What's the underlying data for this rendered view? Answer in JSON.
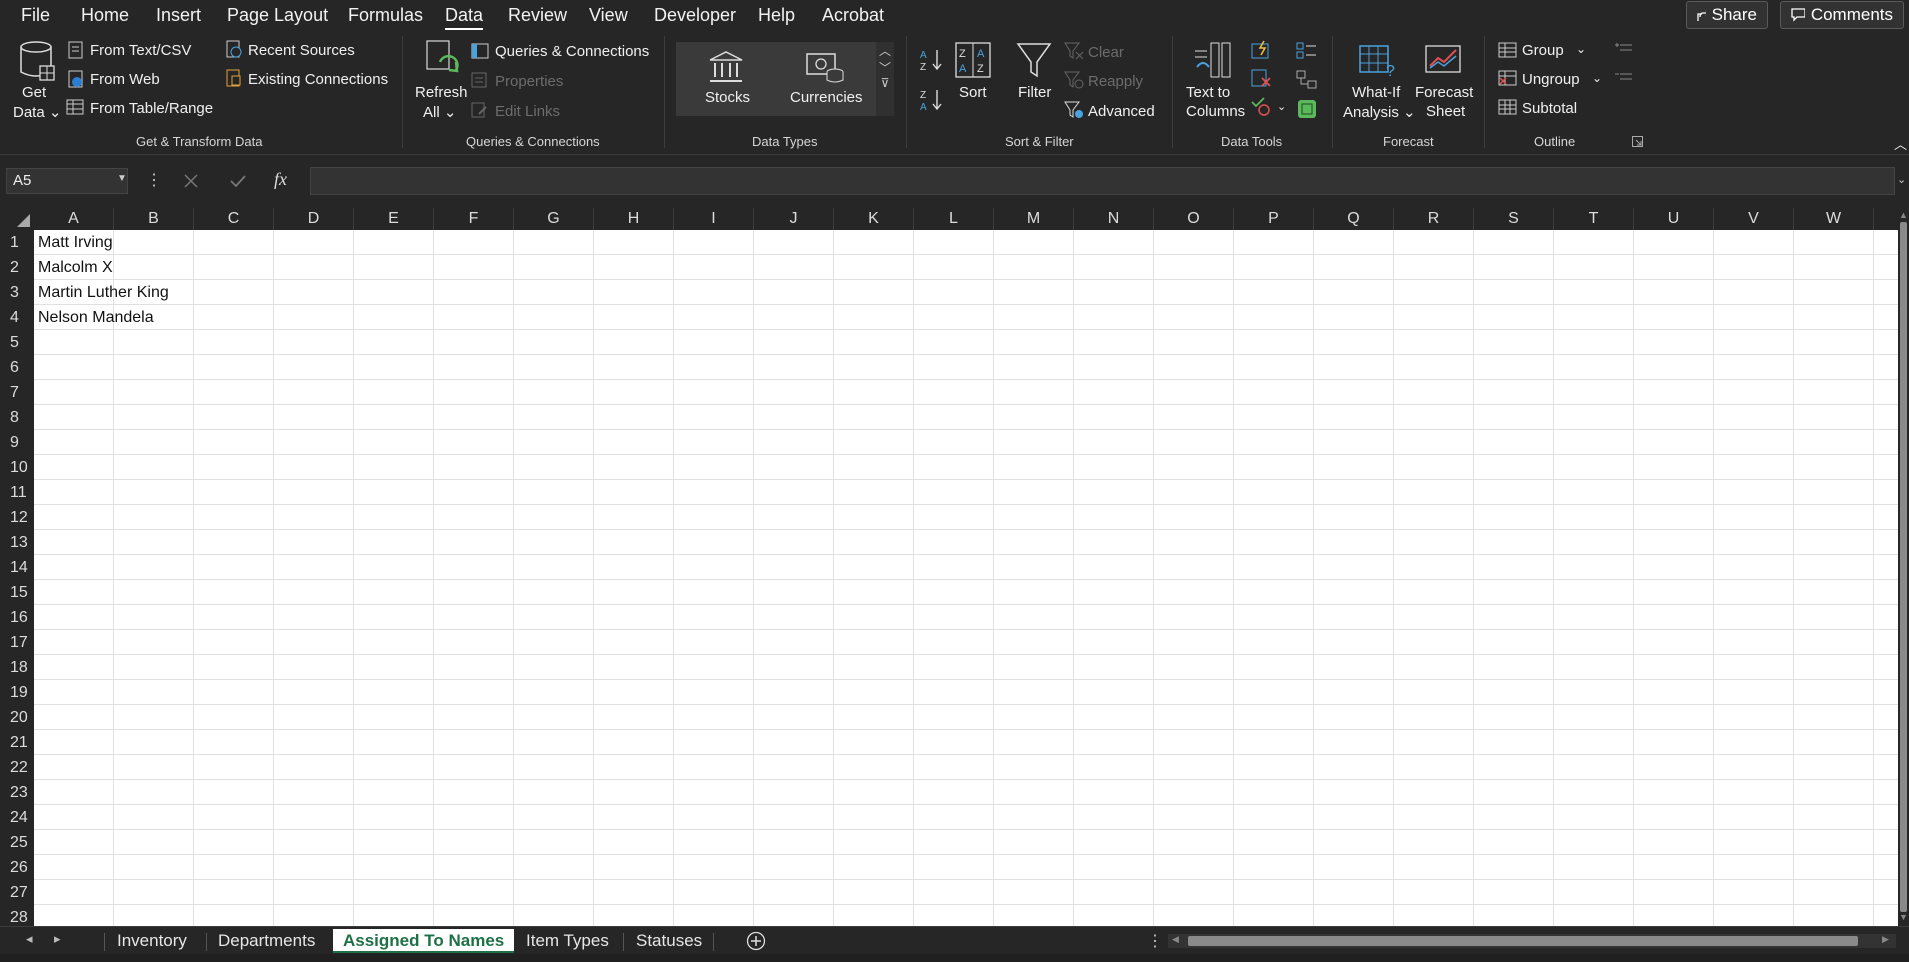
{
  "menu": {
    "items": [
      "File",
      "Home",
      "Insert",
      "Page Layout",
      "Formulas",
      "Data",
      "Review",
      "View",
      "Developer",
      "Help",
      "Acrobat"
    ],
    "active": "Data",
    "share_label": "Share",
    "comments_label": "Comments"
  },
  "ribbon": {
    "get_transform": {
      "get_data_line1": "Get",
      "get_data_line2": "Data",
      "from_text_csv": "From Text/CSV",
      "from_web": "From Web",
      "from_table_range": "From Table/Range",
      "recent_sources": "Recent Sources",
      "existing_connections": "Existing Connections",
      "group_label": "Get & Transform Data"
    },
    "queries": {
      "refresh_line1": "Refresh",
      "refresh_line2": "All",
      "queries_connections": "Queries & Connections",
      "properties": "Properties",
      "edit_links": "Edit Links",
      "group_label": "Queries & Connections"
    },
    "data_types": {
      "stocks": "Stocks",
      "currencies": "Currencies",
      "group_label": "Data Types"
    },
    "sort_filter": {
      "sort": "Sort",
      "filter": "Filter",
      "clear": "Clear",
      "reapply": "Reapply",
      "advanced": "Advanced",
      "group_label": "Sort & Filter"
    },
    "data_tools": {
      "text_to_line1": "Text to",
      "text_to_line2": "Columns",
      "group_label": "Data Tools"
    },
    "forecast": {
      "whatif_line1": "What-If",
      "whatif_line2": "Analysis",
      "forecast_line1": "Forecast",
      "forecast_line2": "Sheet",
      "group_label": "Forecast"
    },
    "outline": {
      "group": "Group",
      "ungroup": "Ungroup",
      "subtotal": "Subtotal",
      "group_label": "Outline"
    }
  },
  "formula_bar": {
    "name_box": "A5",
    "fx_symbol": "fx",
    "content": ""
  },
  "grid": {
    "columns": [
      "A",
      "B",
      "C",
      "D",
      "E",
      "F",
      "G",
      "H",
      "I",
      "J",
      "K",
      "L",
      "M",
      "N",
      "O",
      "P",
      "Q",
      "R",
      "S",
      "T",
      "U",
      "V",
      "W"
    ],
    "rows": [
      "1",
      "2",
      "3",
      "4",
      "5",
      "6",
      "7",
      "8",
      "9",
      "10",
      "11",
      "12",
      "13",
      "14",
      "15",
      "16",
      "17",
      "18",
      "19",
      "20",
      "21",
      "22",
      "23",
      "24",
      "25",
      "26",
      "27",
      "28"
    ],
    "cells_col_a": [
      "Matt Irving",
      "Malcolm X",
      "Martin Luther King",
      "Nelson Mandela"
    ]
  },
  "sheets": {
    "tabs": [
      "Inventory",
      "Departments",
      "Assigned To Names",
      "Item Types",
      "Statuses"
    ],
    "active": "Assigned To Names"
  },
  "colors": {
    "background": "#262626",
    "sheet_active_text": "#1e7145",
    "grid_line": "#e0e0e0"
  }
}
